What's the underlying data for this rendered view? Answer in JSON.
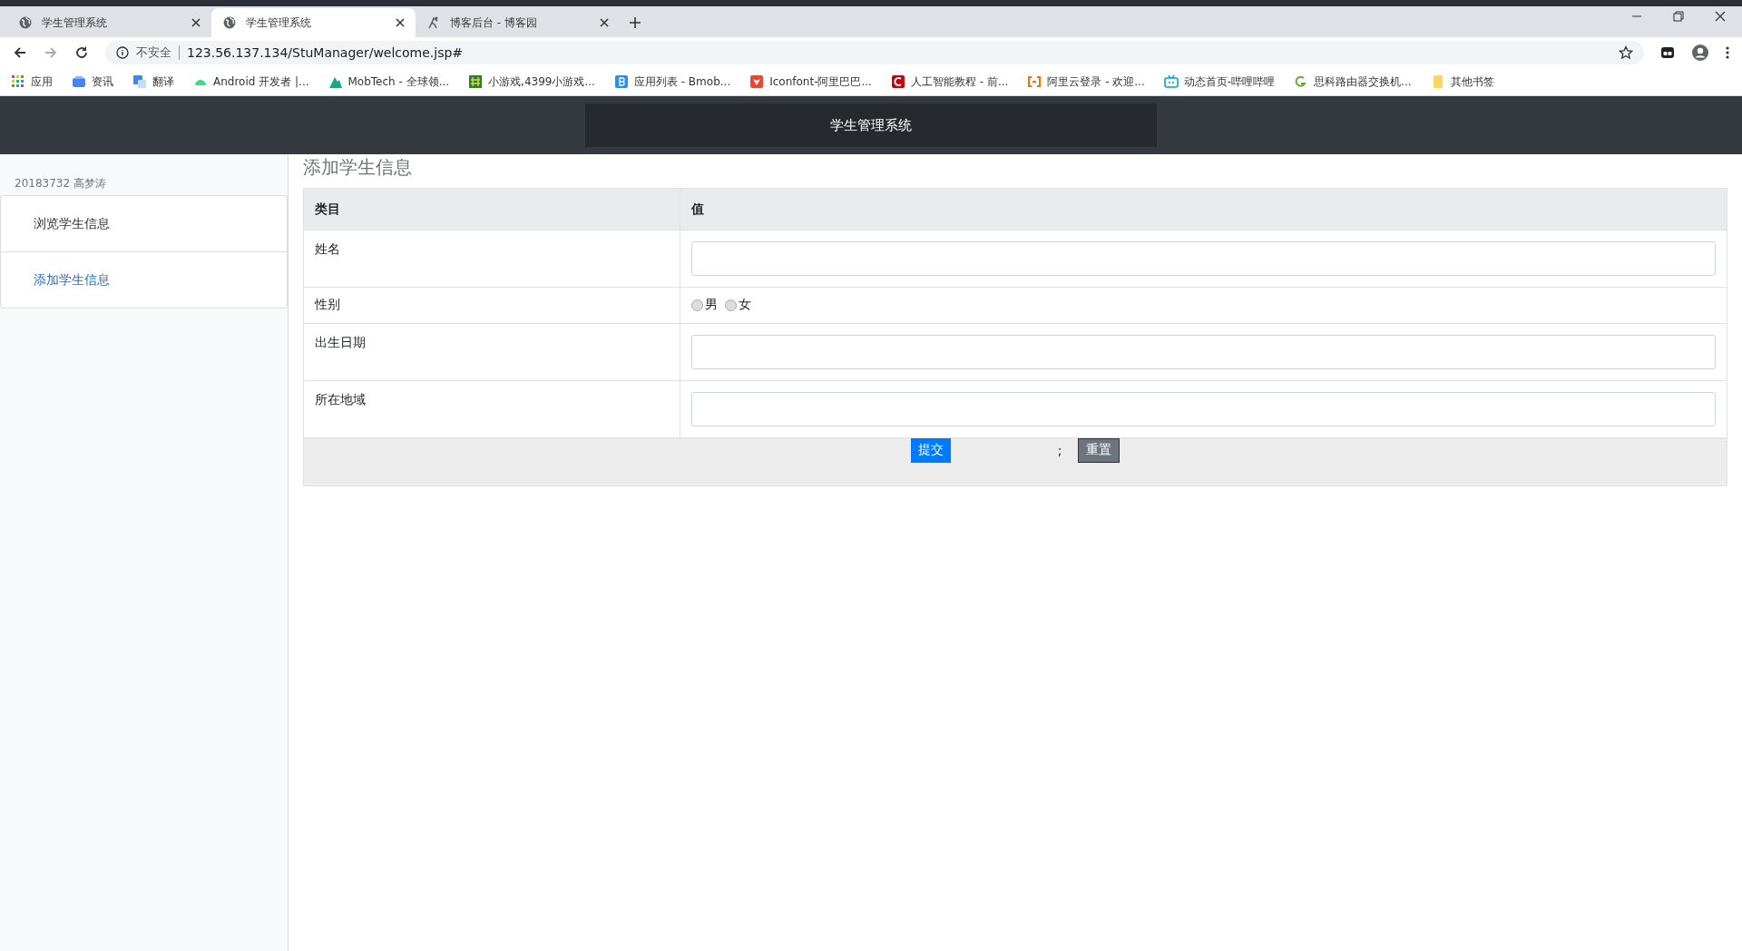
{
  "browser": {
    "tabs": [
      {
        "title": "学生管理系统",
        "kind": "globe",
        "selected": false
      },
      {
        "title": "学生管理系统",
        "kind": "globe",
        "selected": true
      },
      {
        "title": "博客后台 - 博客园",
        "kind": "blog",
        "selected": false
      }
    ],
    "security_label": "不安全",
    "url": "123.56.137.134/StuManager/welcome.jsp#",
    "bookmarks": [
      {
        "label": "应用",
        "kind": "apps"
      },
      {
        "label": "资讯",
        "kind": "news"
      },
      {
        "label": "翻译",
        "kind": "translate"
      },
      {
        "label": "Android 开发者 |...",
        "kind": "android"
      },
      {
        "label": "MobTech - 全球领...",
        "kind": "mobtech"
      },
      {
        "label": "小游戏,4399小游戏...",
        "kind": "game"
      },
      {
        "label": "应用列表 - Bmob...",
        "kind": "bmob"
      },
      {
        "label": "Iconfont-阿里巴巴...",
        "kind": "iconfont"
      },
      {
        "label": "人工智能教程 - 前...",
        "kind": "c"
      },
      {
        "label": "阿里云登录 - 欢迎...",
        "kind": "aliyun"
      },
      {
        "label": "动态首页-哔哩哔哩",
        "kind": "bilibili"
      },
      {
        "label": "思科路由器交换机...",
        "kind": "cisco"
      },
      {
        "label": "其他书签",
        "kind": "folder"
      }
    ]
  },
  "header": {
    "title": "学生管理系统"
  },
  "sidebar": {
    "user": "20183732 高梦涛",
    "items": [
      {
        "label": "浏览学生信息",
        "selected": false
      },
      {
        "label": "添加学生信息",
        "selected": true
      }
    ]
  },
  "main": {
    "title": "添加学生信息",
    "table": {
      "columns": [
        "类目",
        "值"
      ],
      "rows": [
        {
          "label": "姓名",
          "kind": "text"
        },
        {
          "label": "性别",
          "kind": "radio",
          "options": [
            {
              "label": "男",
              "selected": false
            },
            {
              "label": "女",
              "selected": false
            }
          ]
        },
        {
          "label": "出生日期",
          "kind": "text"
        },
        {
          "label": "所在地域",
          "kind": "text"
        }
      ]
    },
    "submit": "提交",
    "separator": ";",
    "reset": "重置"
  }
}
